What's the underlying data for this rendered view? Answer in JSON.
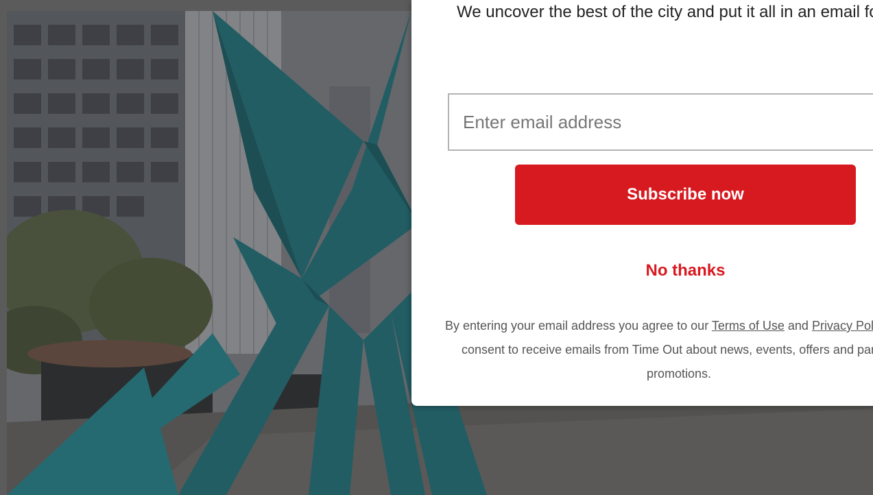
{
  "modal": {
    "heading": "We uncover the best of the city and put it all in an email for you",
    "email_placeholder": "Enter email address",
    "subscribe_label": "Subscribe now",
    "no_thanks_label": "No thanks",
    "legal": {
      "prefix": "By entering your email address you agree to our ",
      "terms_link": "Terms of Use",
      "conjunction": " and ",
      "privacy_link": "Privacy Policy",
      "suffix": " and consent to receive emails from Time Out about news, events, offers and partner promotions."
    }
  },
  "colors": {
    "accent": "#d71920",
    "modal_bg": "#ffffff",
    "overlay": "#5b5b5b"
  },
  "background": {
    "image_subject": "teal origami sculpture in city plaza"
  }
}
